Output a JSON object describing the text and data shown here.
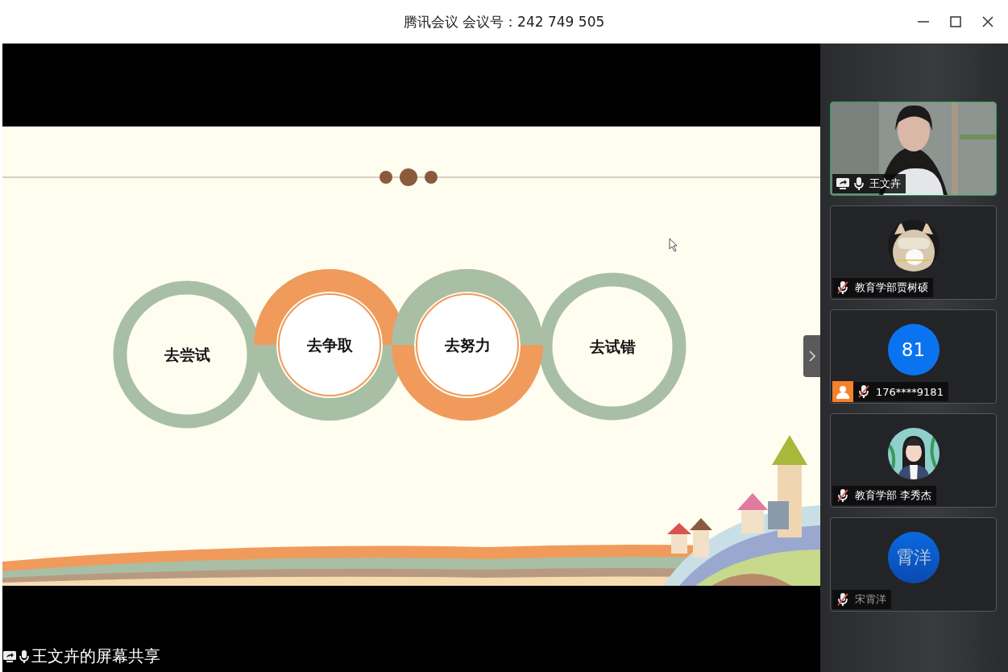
{
  "window": {
    "title": "腾讯会议 会议号：242 749 505"
  },
  "slide": {
    "items": [
      {
        "label": "去尝试",
        "kind": "ring"
      },
      {
        "label": "去争取",
        "kind": "upper"
      },
      {
        "label": "去努力",
        "kind": "lower"
      },
      {
        "label": "去试错",
        "kind": "ring"
      }
    ]
  },
  "presenter": {
    "caption": "王文卉的屏幕共享"
  },
  "participants": [
    {
      "name": "王文卉",
      "kind": "video",
      "muted": false,
      "sharing": true,
      "speaking": true,
      "guest": false,
      "offline": false
    },
    {
      "name": "教育学部贾树硕",
      "muted": true,
      "sharing": false,
      "speaking": false,
      "guest": false,
      "offline": false
    },
    {
      "name": "176****9181",
      "kind": "initials",
      "initials": "81",
      "muted": true,
      "sharing": false,
      "speaking": false,
      "guest": true,
      "offline": false
    },
    {
      "name": "教育学部 李秀杰",
      "kind": "illustration",
      "muted": true,
      "sharing": false,
      "speaking": false,
      "guest": false,
      "offline": false
    },
    {
      "name": "宋霄洋",
      "kind": "initials",
      "initials": "霄洋",
      "muted": true,
      "sharing": false,
      "speaking": false,
      "guest": false,
      "offline": true
    }
  ]
}
